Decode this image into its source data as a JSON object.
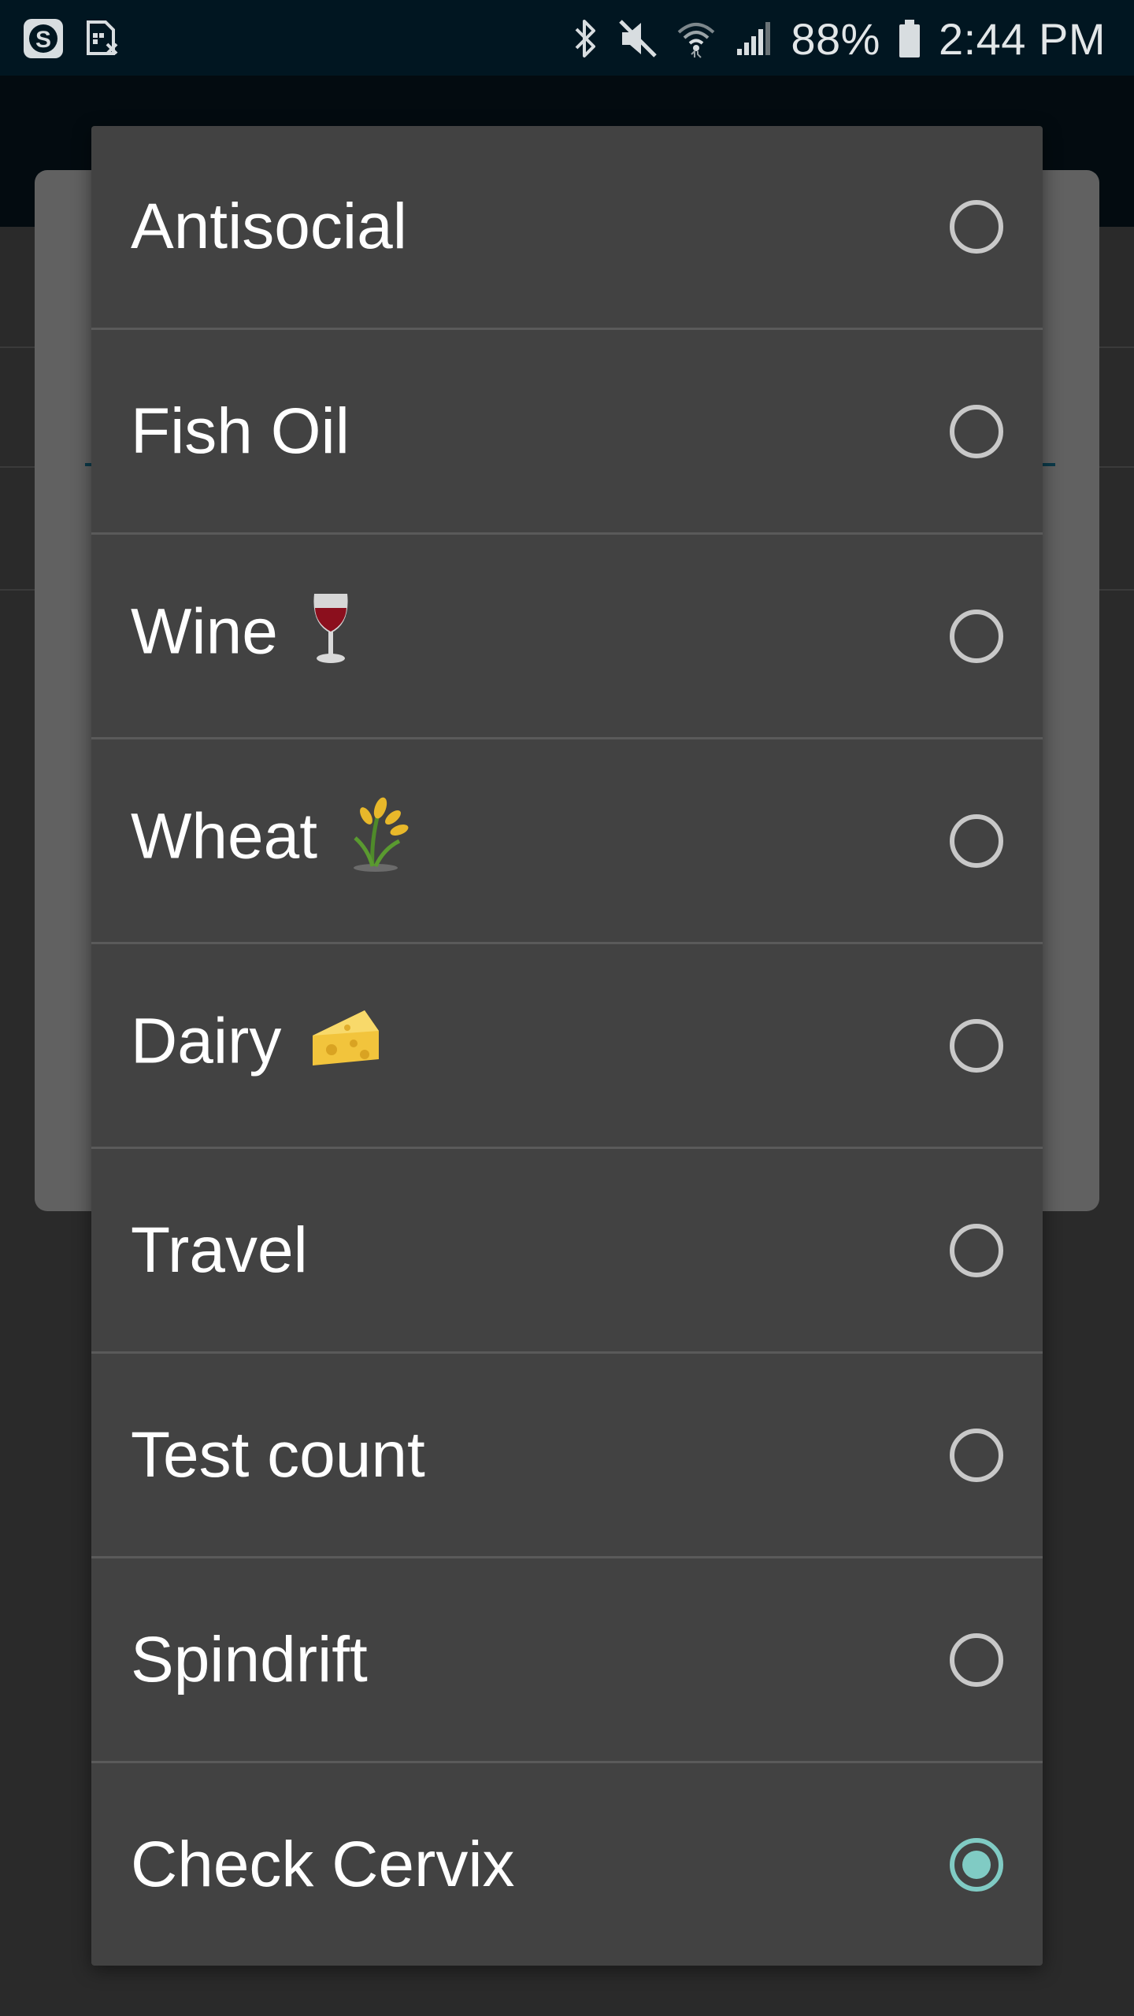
{
  "status_bar": {
    "left_icons": [
      "skype-icon",
      "sim-card-x-icon"
    ],
    "right_icons": [
      "bluetooth-icon",
      "volume-muted-icon",
      "wifi-icon",
      "cell-signal-icon"
    ],
    "battery_percent": "88%",
    "battery_icon": "battery-icon",
    "time": "2:44 PM"
  },
  "choice_dialog": {
    "selected_index": 8,
    "accent_color": "#80cbc4",
    "items": [
      {
        "label": "Antisocial",
        "emoji": null,
        "selected": false
      },
      {
        "label": "Fish Oil",
        "emoji": null,
        "selected": false
      },
      {
        "label": "Wine",
        "emoji": "wine-glass-icon",
        "selected": false
      },
      {
        "label": "Wheat",
        "emoji": "wheat-icon",
        "selected": false
      },
      {
        "label": "Dairy",
        "emoji": "cheese-icon",
        "selected": false
      },
      {
        "label": "Travel",
        "emoji": null,
        "selected": false
      },
      {
        "label": "Test count",
        "emoji": null,
        "selected": false
      },
      {
        "label": "Spindrift",
        "emoji": null,
        "selected": false
      },
      {
        "label": "Check Cervix",
        "emoji": null,
        "selected": true
      }
    ]
  }
}
